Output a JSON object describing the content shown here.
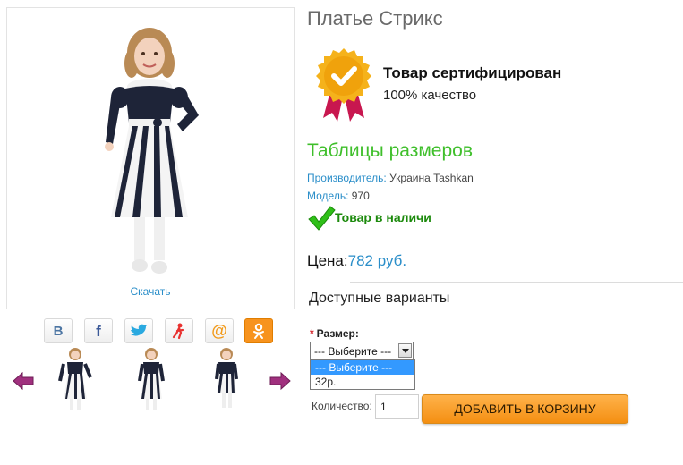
{
  "gallery": {
    "download_label": "Скачать"
  },
  "share": {
    "buttons": [
      "vk-icon",
      "facebook-icon",
      "twitter-icon",
      "odnoklassniki-icon",
      "mail-ru-icon",
      "ok-icon"
    ]
  },
  "product": {
    "title": "Платье Стрикс",
    "cert_title": "Товар сертифицирован",
    "cert_subtitle": "100% качество",
    "size_table_link": "Таблицы размеров",
    "manufacturer_label": "Производитель:",
    "manufacturer_value": " Украина Tashkan",
    "model_label": "Модель:",
    "model_value": " 970",
    "stock_status": "Товар в наличи",
    "price_label": "Цена:",
    "price_value": "782 руб."
  },
  "variants": {
    "title": "Доступные варианты",
    "size_label": "Размер:",
    "size_selected": "--- Выберите ---",
    "size_options": [
      "--- Выберите ---",
      "32р."
    ],
    "quantity_label": "Количество:",
    "quantity_value": "1",
    "add_to_cart_label": "ДОБАВИТЬ В КОРЗИНУ"
  },
  "colors": {
    "link": "#2a8ec9",
    "green_heading": "#3fbf2b",
    "stock_green": "#1c8a0c",
    "cart_button": "#f48f12",
    "arrow_purple": "#a0307e"
  }
}
